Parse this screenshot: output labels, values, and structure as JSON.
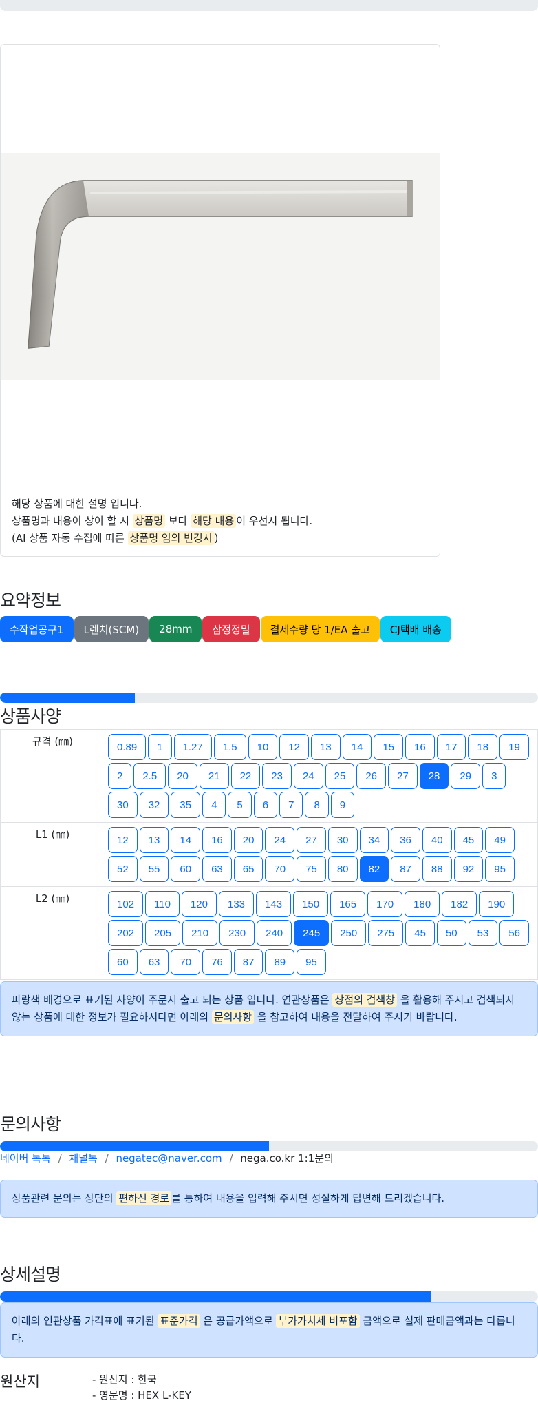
{
  "product_note": {
    "line1": "해당 상품에 대한 설명 입니다.",
    "line2_pre": "상품명과 내용이 상이 할 시",
    "line2_hl1": "상품명",
    "line2_mid": "보다",
    "line2_hl2": "해당 내용",
    "line2_post": "이 우선시 됩니다.",
    "line3_pre": "(AI 상품 자동 수집에 따른",
    "line3_hl": "상품명 임의 변경시",
    "line3_post": ")"
  },
  "summary": {
    "title": "요약정보",
    "badges": [
      {
        "label": "수작업공구1",
        "color": "#0d6efd",
        "text": "#ffffff"
      },
      {
        "label": "L렌치(SCM)",
        "color": "#6c757d",
        "text": "#ffffff"
      },
      {
        "label": "28mm",
        "color": "#198754",
        "text": "#ffffff"
      },
      {
        "label": "삼정정밀",
        "color": "#dc3545",
        "text": "#ffffff"
      },
      {
        "label": "결제수량 당 1/EA 출고",
        "color": "#ffc107",
        "text": "#000000"
      },
      {
        "label": "CJ택배 배송",
        "color": "#0dcaf0",
        "text": "#000000"
      }
    ]
  },
  "spec": {
    "title": "상품사양",
    "progress": 0.25,
    "rows": [
      {
        "label": "규격 (㎜)",
        "selected": "28",
        "options": [
          "0.89",
          "1",
          "1.27",
          "1.5",
          "10",
          "12",
          "13",
          "14",
          "15",
          "16",
          "17",
          "18",
          "19",
          "2",
          "2.5",
          "20",
          "21",
          "22",
          "23",
          "24",
          "25",
          "26",
          "27",
          "28",
          "29",
          "3",
          "30",
          "32",
          "35",
          "4",
          "5",
          "6",
          "7",
          "8",
          "9"
        ]
      },
      {
        "label": "L1 (㎜)",
        "selected": "82",
        "options": [
          "12",
          "13",
          "14",
          "16",
          "20",
          "24",
          "27",
          "30",
          "34",
          "36",
          "40",
          "45",
          "49",
          "52",
          "55",
          "60",
          "63",
          "65",
          "70",
          "75",
          "80",
          "82",
          "87",
          "88",
          "92",
          "95"
        ]
      },
      {
        "label": "L2 (㎜)",
        "selected": "245",
        "options": [
          "102",
          "110",
          "120",
          "133",
          "143",
          "150",
          "165",
          "170",
          "180",
          "182",
          "190",
          "202",
          "205",
          "210",
          "230",
          "240",
          "245",
          "250",
          "275",
          "45",
          "50",
          "53",
          "56",
          "60",
          "63",
          "70",
          "76",
          "87",
          "89",
          "95"
        ]
      }
    ],
    "notice_pre": "파랑색 배경으로 표기된 사양이 주문시 출고 되는 상품 입니다. 연관상품은",
    "notice_hl1": "상점의 검색창",
    "notice_mid": "을 활용해 주시고 검색되지 않는 상품에 대한 정보가 필요하시다면 아래의",
    "notice_hl2": "문의사항",
    "notice_post": "을 참고하여 내용을 전달하여 주시기 바랍니다."
  },
  "inquiry": {
    "title": "문의사항",
    "progress": 0.5,
    "links": [
      "네이버 톡톡",
      "채널톡",
      "negatec@naver.com"
    ],
    "current": "nega.co.kr 1:1문의",
    "separator": "/",
    "notice_pre": "상품관련 문의는 상단의",
    "notice_hl": "편하신 경로",
    "notice_post": "를 통하여 내용을 입력해 주시면 성실하게 답변해 드리겠습니다."
  },
  "detail": {
    "title": "상세설명",
    "progress": 0.8,
    "notice_pre": "아래의 연관상품 가격표에 표기된",
    "notice_hl1": "표준가격",
    "notice_mid": "은 공급가액으로",
    "notice_hl2": "부가가치세 비포함",
    "notice_post": "금액으로 실제 판매금액과는 다릅니다."
  },
  "origin": {
    "label": "원산지",
    "line1": "- 원산지 : 한국",
    "line2": "- 영문명 : HEX L-KEY"
  }
}
